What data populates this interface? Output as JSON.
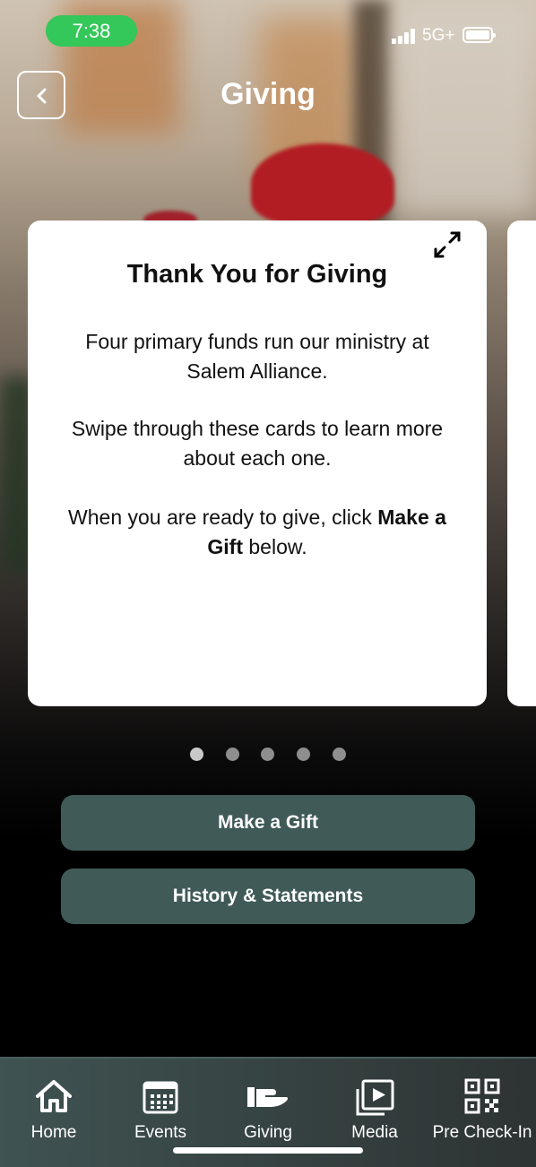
{
  "status_bar": {
    "time": "7:38",
    "network": "5G+"
  },
  "header": {
    "title": "Giving"
  },
  "card": {
    "title": "Thank You for Giving",
    "paragraph1": "Four primary funds run our ministry at Salem Alliance.",
    "paragraph2": "Swipe through these cards to learn more about each one.",
    "paragraph3_prefix": "When you are ready to give, click ",
    "paragraph3_bold": "Make a Gift",
    "paragraph3_suffix": " below."
  },
  "pager": {
    "total": 5,
    "active_index": 0
  },
  "buttons": {
    "make_gift": "Make a Gift",
    "history": "History & Statements"
  },
  "tabbar": {
    "items": [
      {
        "label": "Home",
        "icon": "home-icon"
      },
      {
        "label": "Events",
        "icon": "calendar-icon"
      },
      {
        "label": "Giving",
        "icon": "giving-hand-icon"
      },
      {
        "label": "Media",
        "icon": "media-icon"
      },
      {
        "label": "Pre Check-In",
        "icon": "qr-code-icon"
      }
    ]
  },
  "colors": {
    "accent": "#405a58",
    "status_pill": "#34c759"
  }
}
